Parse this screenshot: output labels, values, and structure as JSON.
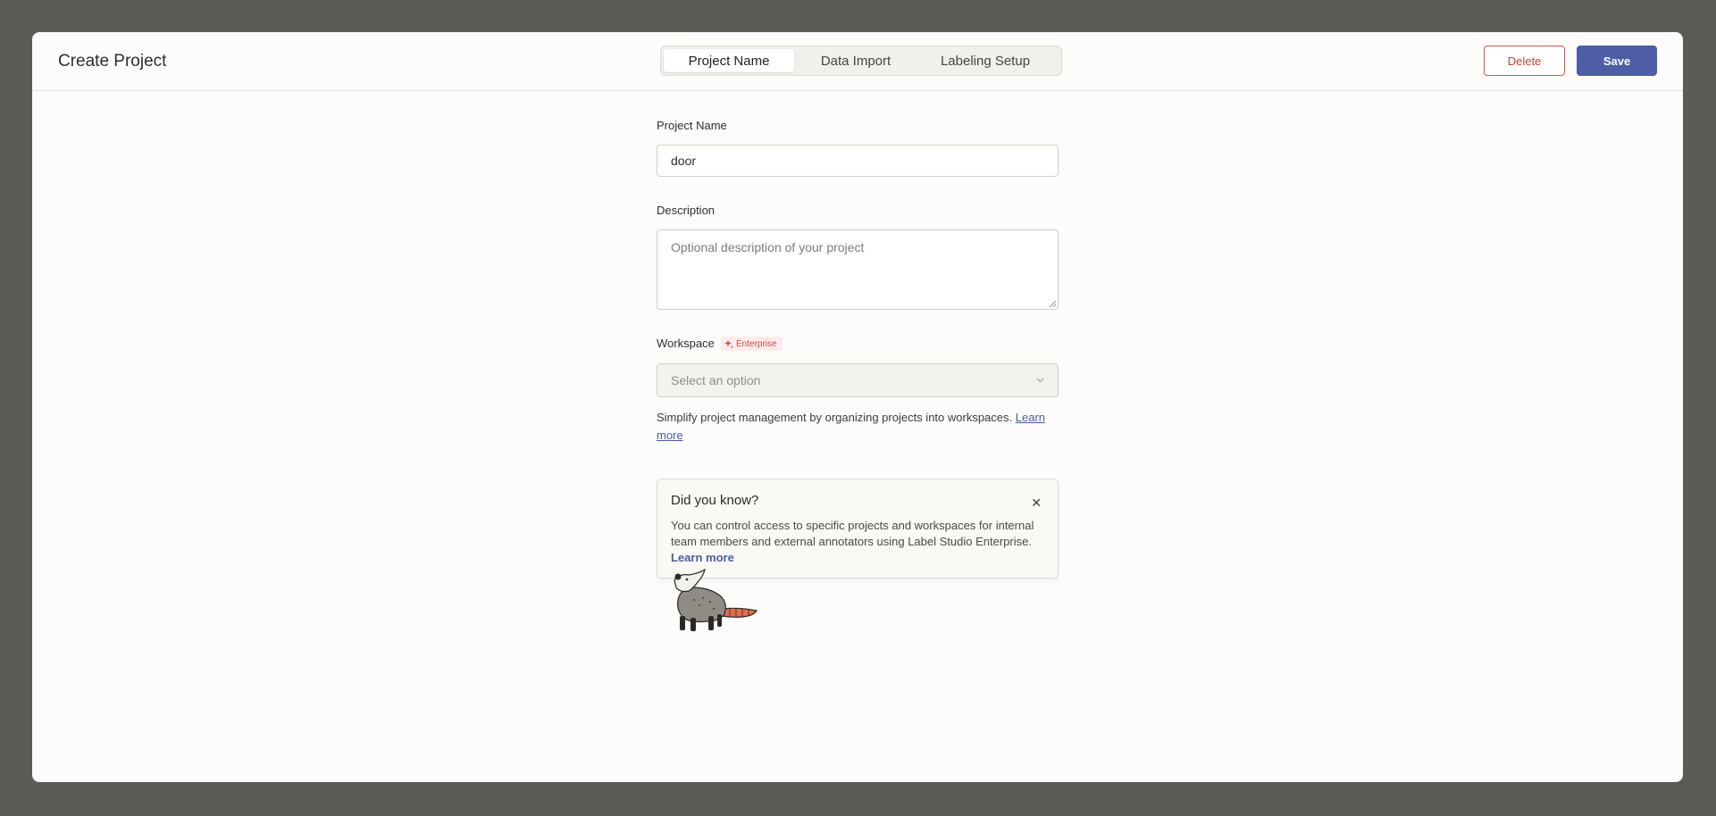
{
  "header": {
    "title": "Create Project",
    "tabs": [
      {
        "label": "Project Name",
        "active": true
      },
      {
        "label": "Data Import",
        "active": false
      },
      {
        "label": "Labeling Setup",
        "active": false
      }
    ],
    "delete_label": "Delete",
    "save_label": "Save"
  },
  "form": {
    "name_label": "Project Name",
    "name_value": "door",
    "description_label": "Description",
    "description_placeholder": "Optional description of your project",
    "workspace_label": "Workspace",
    "enterprise_badge": "Enterprise",
    "workspace_placeholder": "Select an option",
    "workspace_help": "Simplify project management by organizing projects into workspaces.",
    "workspace_help_link": "Learn more"
  },
  "tip": {
    "title": "Did you know?",
    "text": "You can control access to specific projects and workspaces for internal team members and external annotators using Label Studio Enterprise.",
    "link": "Learn more"
  },
  "colors": {
    "accent": "#4d5ea6",
    "danger": "#c9403b",
    "backdrop": "#5c5b57"
  },
  "icons": {
    "close": "close-icon",
    "select": "chevron-down-icon",
    "enterprise": "sparkle-icon"
  }
}
